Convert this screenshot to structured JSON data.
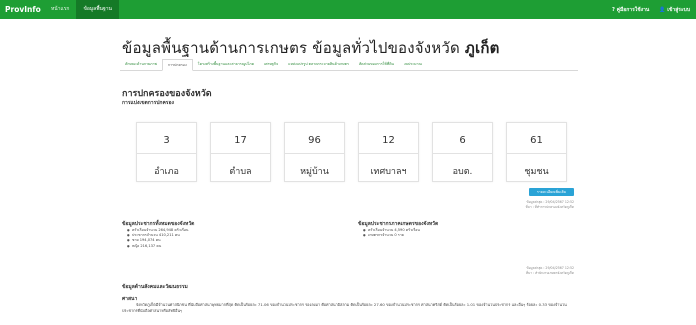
{
  "navbar": {
    "brand": "ProvInfo",
    "links": [
      {
        "label": "หน้าแรก",
        "active": false
      },
      {
        "label": "ข้อมูลพื้นฐาน",
        "active": true
      }
    ],
    "right": {
      "help": "? คู่มือการใช้งาน",
      "user": "เข้าสู่ระบบ"
    }
  },
  "page": {
    "title_prefix": "ข้อมูลพื้นฐานด้านการเกษตร ข้อมูลทั่วไปของจังหวัด",
    "title_province": "ภูเก็ต"
  },
  "tabs": [
    {
      "label": "ลักษณะด้านกายภาพ",
      "active": false
    },
    {
      "label": "การปกครอง",
      "active": true
    },
    {
      "label": "โครงสร้างพื้นฐานและสาธารณูปโภค",
      "active": false
    },
    {
      "label": "เศรษฐกิจ",
      "active": false
    },
    {
      "label": "แหล่งแปรรูป ตลาดกระจายสินค้าเกษตร",
      "active": false
    },
    {
      "label": "สัดส่วนของการใช้ที่ดิน",
      "active": false
    },
    {
      "label": "งบประมาณ",
      "active": false
    }
  ],
  "governance": {
    "title": "การปกครองของจังหวัด",
    "subtitle": "การแบ่งเขตการปกครอง",
    "stats": [
      {
        "value": "3",
        "label": "อำเภอ"
      },
      {
        "value": "17",
        "label": "ตำบล"
      },
      {
        "value": "96",
        "label": "หมู่บ้าน"
      },
      {
        "value": "12",
        "label": "เทศบาลฯ"
      },
      {
        "value": "6",
        "label": "อบต."
      },
      {
        "value": "61",
        "label": "ชุมชน"
      }
    ],
    "detail_button": "รายละเอียดเพิ่มเติม",
    "update_line1": "ข้อมูลล่าสุด : 29/04/2567 12:52",
    "update_line2": "ที่มา : ที่ทำการปกครองจังหวัดภูเก็ต"
  },
  "population": {
    "title": "ข้อมูลประชากรทั้งหมดของจังหวัด",
    "items": [
      "ครัวเรือนจำนวน 264,948 ครัวเรือน",
      "ประชากรจำนวน 410,211 คน",
      "ชาย 194,074 คน",
      "หญิง 216,137 คน"
    ]
  },
  "agri_population": {
    "title": "ข้อมูลประชากรภาคเกษตรของจังหวัด",
    "items": [
      "ครัวเรือนจำนวน 4,590 ครัวเรือน",
      "เกษตรกรจำนวน 0 ราย"
    ],
    "update_line1": "ข้อมูลล่าสุด : 29/04/2567 12:52",
    "update_line2": "ที่มา : สำนักงานเกษตรจังหวัดภูเก็ต"
  },
  "society": {
    "title": "ข้อมูลด้านสังคมและวัฒนธรรม",
    "religion_label": "ศาสนา",
    "religion_text": "จังหวัดภูเก็ตมีจำนวนศาสนิกชน ที่นับถือศาสนาพุทธมากที่สุด คิดเป็นร้อยละ 71.06 ของจำนวนประชากร รองลงมา คือศาสนาอิสลาม คิดเป็นร้อยละ 27.60 ของจำนวนประชากร ศาสนาคริสต์ คิดเป็นร้อยละ 1.01 ของจำนวนประชากร และอื่นๆ ร้อยละ 0.33 ของจำนวนประชากรที่นับถือศาสนาหรือลัทธิอื่นๆ"
  },
  "colors": {
    "nav_green": "#1e9e34",
    "tab_link": "#2d8a3a",
    "button_blue": "#2aa3d6"
  }
}
